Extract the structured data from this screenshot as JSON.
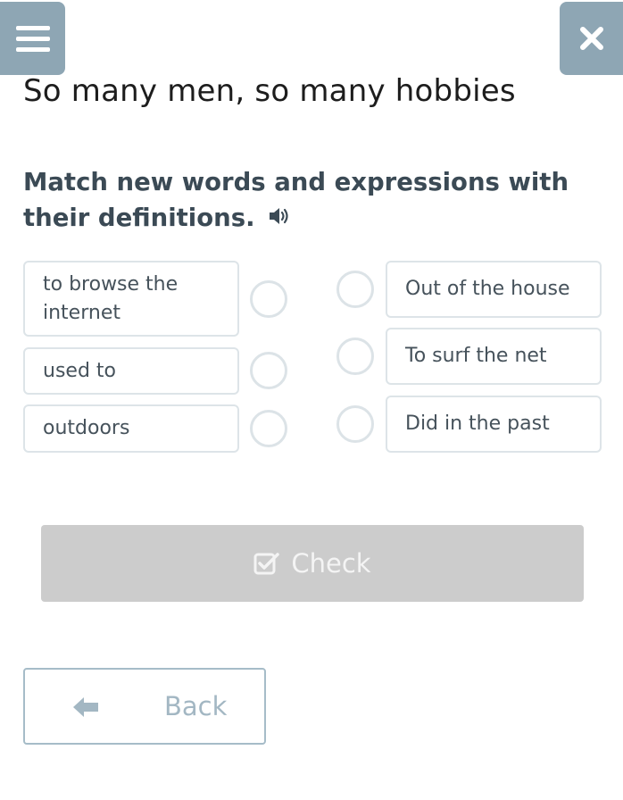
{
  "header": {
    "menu_icon": "hamburger-icon",
    "close_icon": "close-icon"
  },
  "title": "So many men, so many hobbies",
  "instruction": "Match new words and expressions with their definitions.",
  "speaker_icon": "speaker-icon",
  "left_items": [
    {
      "label": "to browse the internet"
    },
    {
      "label": "used to"
    },
    {
      "label": "outdoors"
    }
  ],
  "right_items": [
    {
      "label": "Out of the house"
    },
    {
      "label": "To surf the net"
    },
    {
      "label": "Did in the past"
    }
  ],
  "check_button": {
    "label": "Check",
    "icon": "checkbox-pen-icon"
  },
  "back_button": {
    "label": "Back",
    "icon": "arrow-left-icon"
  },
  "colors": {
    "header_button": "#8ea6b4",
    "check_disabled": "#cccccc",
    "back_border": "#a6bcc8"
  }
}
